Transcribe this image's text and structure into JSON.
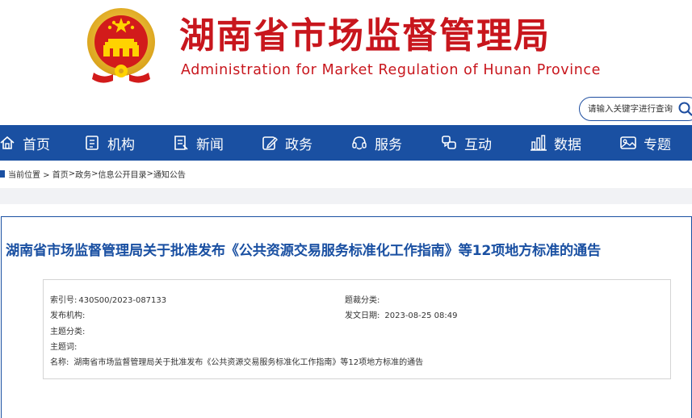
{
  "header": {
    "title": "湖南省市场监督管理局",
    "subtitle": "Administration for Market Regulation of Hunan Province",
    "emblem_icon": "national-emblem-icon"
  },
  "search": {
    "placeholder": "请输入关键字进行查询",
    "icon": "search-icon"
  },
  "nav": {
    "items": [
      {
        "label": "首页",
        "icon": "home-icon"
      },
      {
        "label": "机构",
        "icon": "building-icon"
      },
      {
        "label": "新闻",
        "icon": "news-icon"
      },
      {
        "label": "政务",
        "icon": "edit-icon"
      },
      {
        "label": "服务",
        "icon": "service-icon"
      },
      {
        "label": "互动",
        "icon": "interaction-icon"
      },
      {
        "label": "数据",
        "icon": "bar-chart-icon"
      },
      {
        "label": "专题",
        "icon": "image-icon"
      }
    ]
  },
  "breadcrumb": {
    "prefix": "当前位置 > ",
    "items": [
      "首页",
      "政务",
      "信息公开目录",
      "通知公告"
    ],
    "separators": [
      ">",
      ">",
      ">"
    ]
  },
  "article": {
    "title": "湖南省市场监督管理局关于批准发布《公共资源交易服务标准化工作指南》等12项地方标准的通告",
    "meta": {
      "index_label": "索引号:",
      "index_value": "430S00/2023-087133",
      "subject_cat_label": "题裁分类:",
      "subject_cat_value": "",
      "publisher_label": "发布机构:",
      "publisher_value": "",
      "date_label": "发文日期:",
      "date_value": "2023-08-25 08:49",
      "topic_label": "主题分类:",
      "topic_value": "",
      "keywords_label": "主题词:",
      "keywords_value": "",
      "name_label": "名称:",
      "name_value": "湖南省市场监督管理局关于批准发布《公共资源交易服务标准化工作指南》等12项地方标准的通告"
    }
  },
  "colors": {
    "brand_red": "#c8161d",
    "nav_blue": "#1a50a2"
  }
}
